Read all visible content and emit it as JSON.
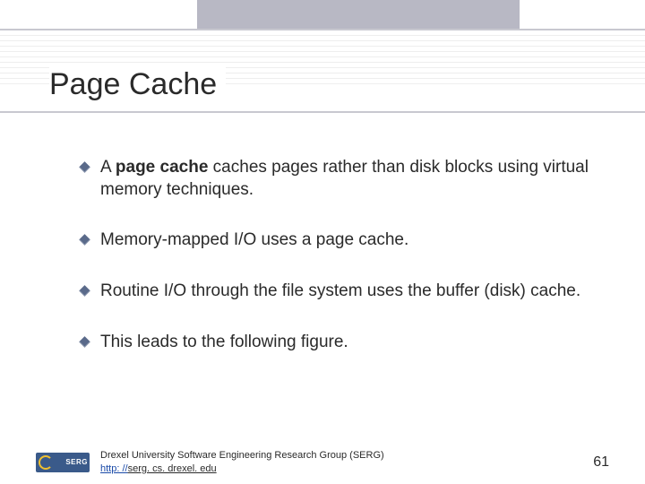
{
  "title": "Page Cache",
  "bullets": [
    {
      "pre": "A ",
      "bold": "page cache",
      "post": " caches pages rather than disk blocks using virtual memory techniques."
    },
    {
      "pre": "",
      "bold": "",
      "post": "Memory-mapped I/O uses a page cache."
    },
    {
      "pre": "",
      "bold": "",
      "post": "Routine I/O through the file system uses the buffer (disk) cache."
    },
    {
      "pre": "",
      "bold": "",
      "post": "This leads to the following figure."
    }
  ],
  "footer": {
    "logo_text": "SERG",
    "org": "Drexel University Software Engineering Research Group (SERG)",
    "link_prefix": "http: //",
    "link_rest": "serg. cs. drexel. edu"
  },
  "page_number": "61"
}
